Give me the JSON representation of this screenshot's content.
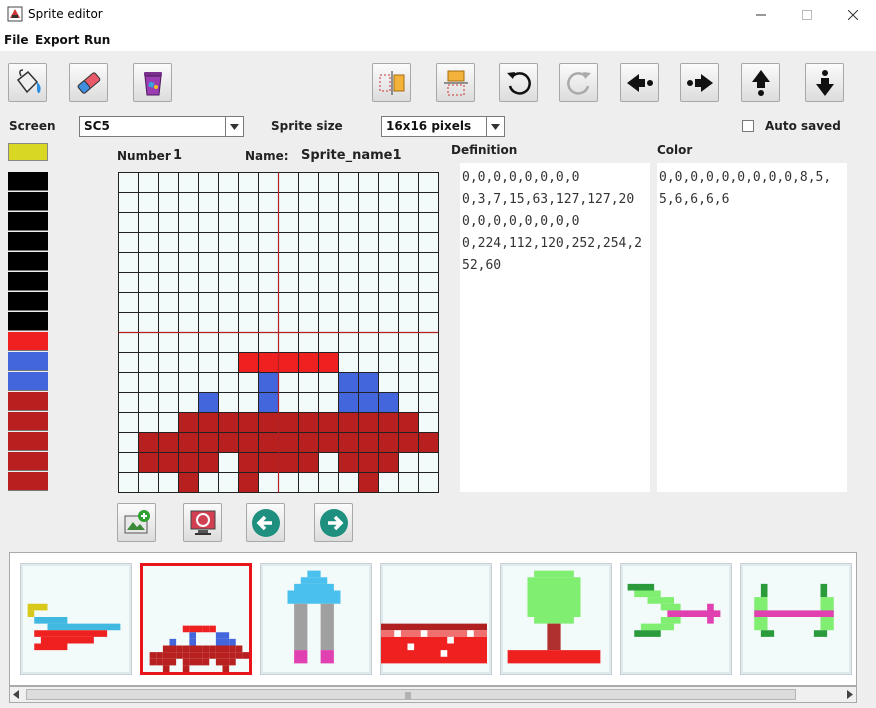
{
  "window": {
    "title": "Sprite editor"
  },
  "menu": [
    "File",
    "Export",
    "Run"
  ],
  "toolbar": {
    "left": [
      "paint-bucket-icon",
      "eraser-icon",
      "trash-icon"
    ],
    "right": [
      "flip-horizontal-icon",
      "flip-vertical-icon",
      "rotate-left-icon",
      "rotate-right-icon",
      "shift-left-icon",
      "shift-right-icon",
      "shift-up-icon",
      "shift-down-icon"
    ]
  },
  "screen": {
    "label": "Screen",
    "value": "SC5"
  },
  "sprite_size": {
    "label": "Sprite size",
    "value": "16x16 pixels"
  },
  "autosave": {
    "label": "Auto saved",
    "checked": false
  },
  "palette": {
    "selected_color": "#d8d824",
    "colors": [
      "#000000",
      "#000000",
      "#000000",
      "#000000",
      "#000000",
      "#000000",
      "#000000",
      "#000000",
      "#ee2020",
      "#4466dd",
      "#4466dd",
      "#b82020",
      "#b82020",
      "#b82020",
      "#b82020",
      "#b82020"
    ]
  },
  "sprite": {
    "number_label": "Number",
    "number": "1",
    "name_label": "Name:",
    "name": "Sprite_name1",
    "grid_rows": [
      "................",
      "................",
      "................",
      "................",
      "................",
      "................",
      "................",
      "................",
      "................",
      "......RRRRR.....",
      ".......B...BB...",
      "....B..B...BBB..",
      "...DDDDDDDDDDDD..",
      ".DDDDDDDDDDDDDDD",
      ".DDDD.DDDD.DDD..",
      "...D..D.....D..."
    ],
    "colors": {
      "R": "#ee2020",
      "B": "#4466dd",
      "D": "#b82020"
    }
  },
  "definition": {
    "label": "Definition",
    "text": "0,0,0,0,0,0,0,0\n0,3,7,15,63,127,127,20\n0,0,0,0,0,0,0,0\n0,224,112,120,252,254,252,60"
  },
  "color_def": {
    "label": "Color",
    "text": "0,0,0,0,0,0,0,0,0,8,5,5,6,6,6,6"
  },
  "bottom_buttons": [
    "add-image-icon",
    "refresh-screen-icon",
    "arrow-left-icon",
    "arrow-right-icon"
  ],
  "thumbnails": [
    "plane",
    "car",
    "mushroom",
    "wall",
    "tree",
    "bird",
    "dumbbell"
  ],
  "selected_thumbnail": 1
}
